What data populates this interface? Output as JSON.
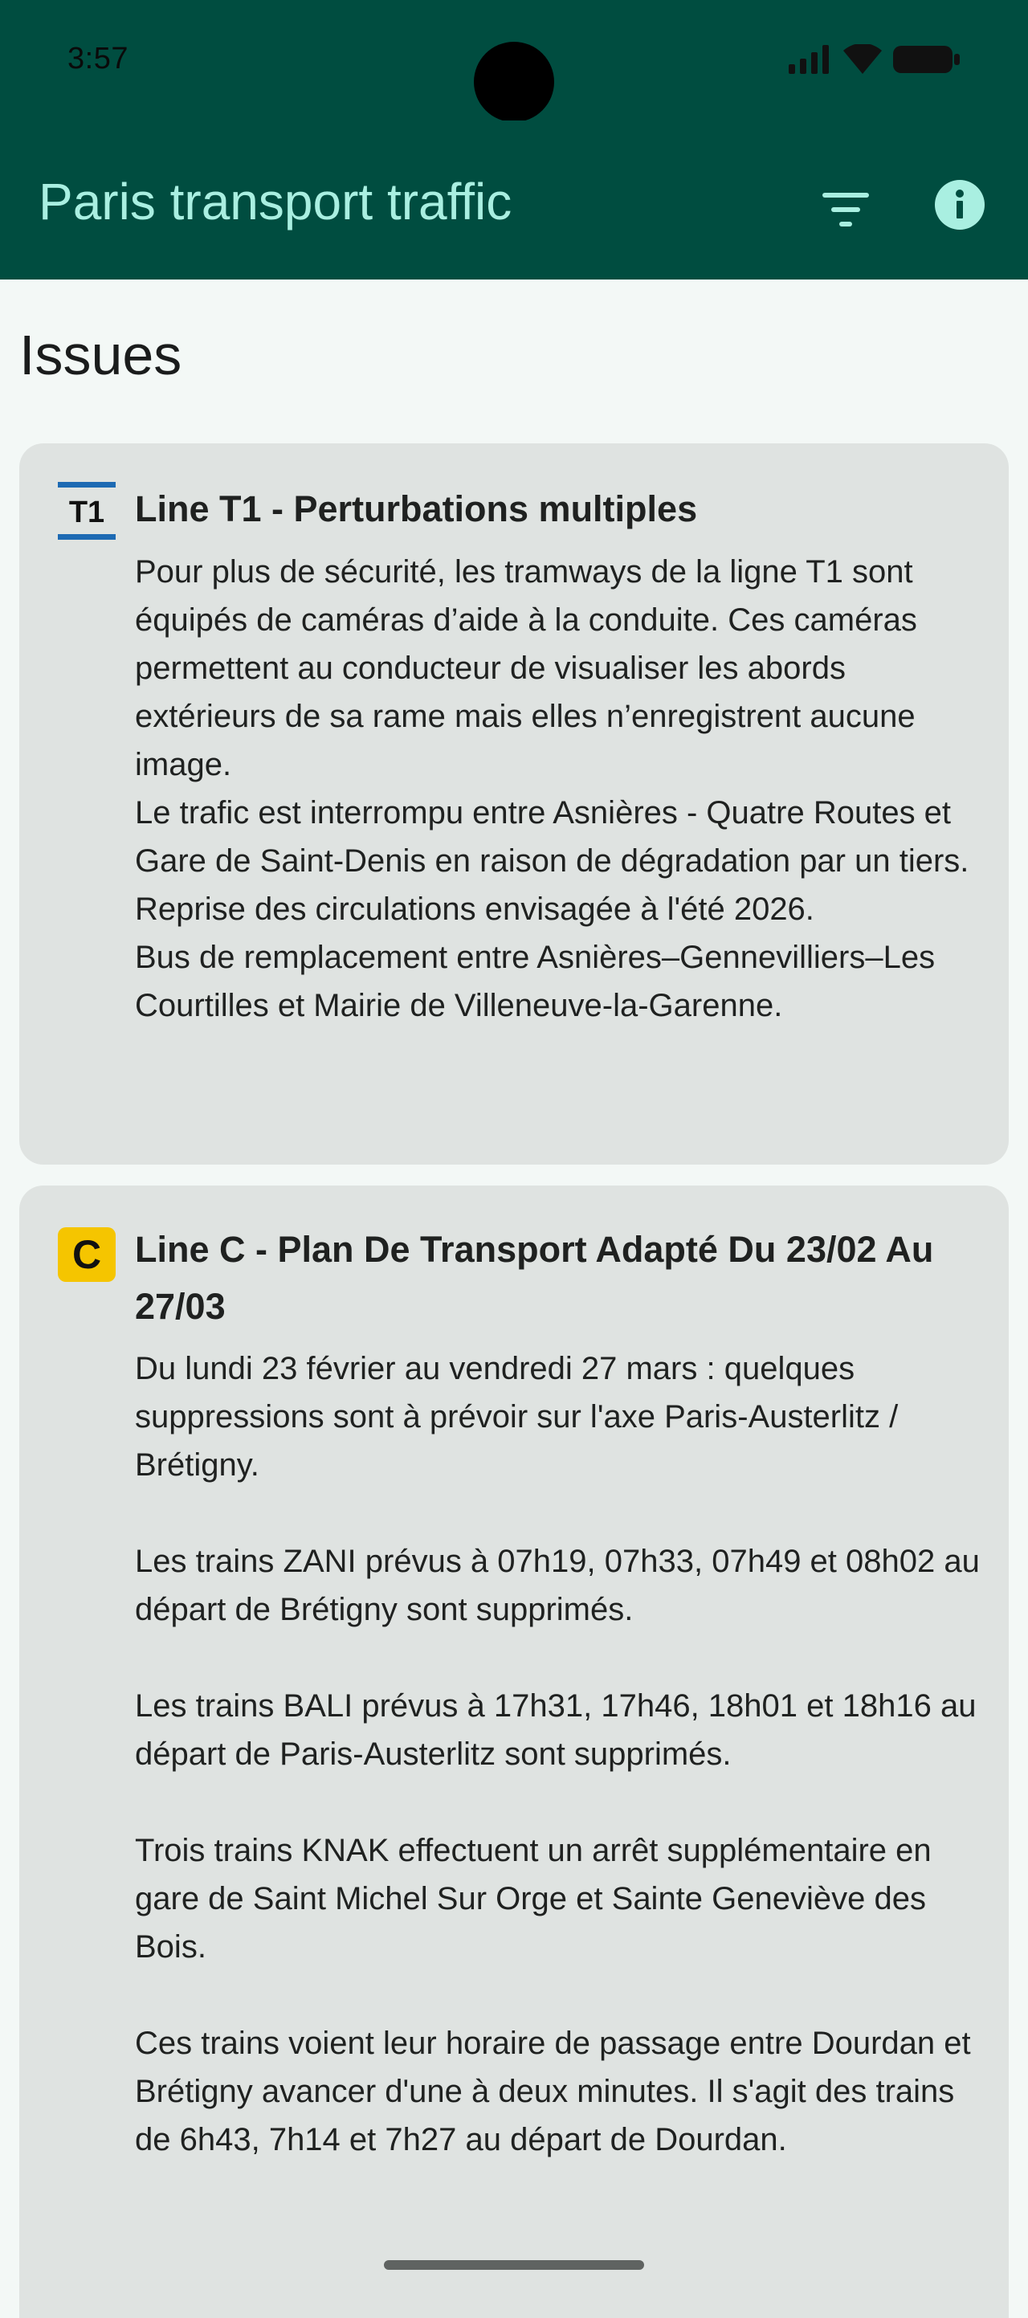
{
  "status_bar": {
    "time": "3:57",
    "icons": [
      "signal-icon",
      "wifi-icon",
      "battery-icon"
    ]
  },
  "app_bar": {
    "title": "Paris transport traffic",
    "actions": [
      "filter-icon",
      "info-icon"
    ]
  },
  "colors": {
    "app_bar": "#004d40",
    "title_text": "#a9efe1",
    "card_bg": "#dfe3e1",
    "line_c_badge": "#f5c500",
    "line_t1_badge": "#1d6ab3"
  },
  "section": {
    "title": "Issues"
  },
  "issues": [
    {
      "badge": "T1",
      "title": "Line T1 - Perturbations multiples",
      "paragraphs": [
        "Pour plus de sécurité, les tramways de la ligne T1 sont équipés de caméras d’aide à la conduite. Ces caméras permettent au conducteur de visualiser les abords extérieurs de sa rame mais elles n’enregistrent aucune image.",
        "Le trafic est interrompu entre Asnières - Quatre Routes et Gare de Saint-Denis en raison de dégradation par un tiers. Reprise des circulations envisagée à l'été 2026.",
        "Bus de remplacement entre Asnières–Gennevilliers–Les Courtilles et Mairie de Villeneuve-la-Garenne."
      ]
    },
    {
      "badge": "C",
      "title": "Line C - Plan De Transport Adapté Du 23/02 Au 27/03",
      "paragraphs": [
        "Du lundi 23 février au vendredi 27 mars : quelques suppressions sont à prévoir sur l'axe Paris-Austerlitz / Brétigny.",
        "Les trains ZANI prévus à 07h19, 07h33, 07h49 et 08h02 au départ de Brétigny sont supprimés.",
        "Les trains BALI prévus à 17h31, 17h46, 18h01 et 18h16 au départ de Paris-Austerlitz sont supprimés.",
        "Trois trains KNAK effectuent un arrêt supplémentaire en gare de Saint Michel Sur Orge et Sainte Geneviève des Bois.",
        "Ces trains voient leur horaire de passage entre Dourdan et Brétigny avancer d'une à deux minutes. Il s'agit des trains de 6h43, 7h14 et 7h27 au départ de Dourdan."
      ]
    }
  ]
}
